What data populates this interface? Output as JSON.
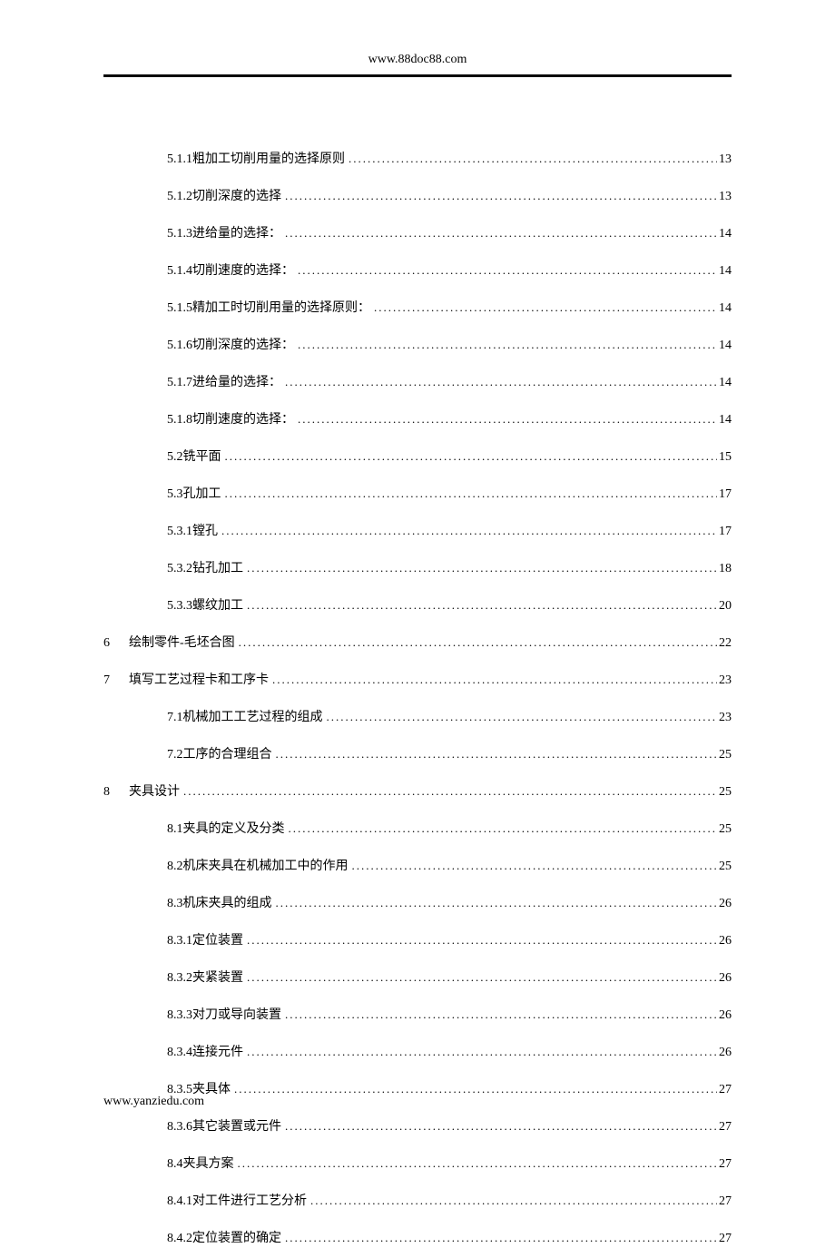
{
  "header": {
    "url": "www.88doc88.com"
  },
  "footer": {
    "url": "www.yanziedu.com"
  },
  "toc": [
    {
      "level": 2,
      "num": "5.1.1",
      "title": "粗加工切削用量的选择原则",
      "page": "13"
    },
    {
      "level": 2,
      "num": "5.1.2",
      "title": " 切削深度的选择",
      "page": "13"
    },
    {
      "level": 2,
      "num": "5.1.3",
      "title": " 进给量的选择：",
      "page": "14"
    },
    {
      "level": 2,
      "num": "5.1.4",
      "title": " 切削速度的选择：",
      "page": "14"
    },
    {
      "level": 2,
      "num": "5.1.5",
      "title": " 精加工时切削用量的选择原则：",
      "page": "14"
    },
    {
      "level": 2,
      "num": "5.1.6",
      "title": " 切削深度的选择：",
      "page": "14"
    },
    {
      "level": 2,
      "num": "5.1.7",
      "title": " 进给量的选择：",
      "page": "14"
    },
    {
      "level": 2,
      "num": "5.1.8",
      "title": " 切削速度的选择：",
      "page": "14"
    },
    {
      "level": 2,
      "num": "5.2",
      "title": "   铣平面",
      "page": "15"
    },
    {
      "level": 2,
      "num": "5.3",
      "title": " 孔加工",
      "page": "17"
    },
    {
      "level": 2,
      "num": "5.3.1",
      "title": " 镗孔",
      "page": "17"
    },
    {
      "level": 2,
      "num": "5.3.2",
      "title": " 钻孔加工",
      "page": "18"
    },
    {
      "level": 2,
      "num": "5.3.3",
      "title": " 螺纹加工",
      "page": "20"
    },
    {
      "level": 0,
      "num": "6",
      "title": "绘制零件-毛坯合图",
      "page": "22"
    },
    {
      "level": 0,
      "num": "7",
      "title": "填写工艺过程卡和工序卡",
      "page": "23"
    },
    {
      "level": 2,
      "num": "7.1",
      "title": " 机械加工工艺过程的组成",
      "page": "23"
    },
    {
      "level": 2,
      "num": "7.2",
      "title": " 工序的合理组合",
      "page": "25"
    },
    {
      "level": 0,
      "num": "8",
      "title": "夹具设计",
      "page": "25"
    },
    {
      "level": 2,
      "num": "8.1",
      "title": "   夹具的定义及分类",
      "page": "25"
    },
    {
      "level": 2,
      "num": "8.2",
      "title": "   机床夹具在机械加工中的作用",
      "page": "25"
    },
    {
      "level": 2,
      "num": "8.3",
      "title": "   机床夹具的组成",
      "page": "26"
    },
    {
      "level": 2,
      "num": "8.3.1",
      "title": "   定位装置",
      "page": "26"
    },
    {
      "level": 2,
      "num": "8.3.2",
      "title": "   夹紧装置",
      "page": "26"
    },
    {
      "level": 2,
      "num": "8.3.3",
      "title": "   对刀或导向装置",
      "page": "26"
    },
    {
      "level": 2,
      "num": "8.3.4",
      "title": "   连接元件",
      "page": "26"
    },
    {
      "level": 2,
      "num": "8.3.5",
      "title": "   夹具体",
      "page": "27"
    },
    {
      "level": 2,
      "num": "8.3.6",
      "title": "   其它装置或元件",
      "page": "27"
    },
    {
      "level": 2,
      "num": "8.4",
      "title": " 夹具方案",
      "page": "27"
    },
    {
      "level": 2,
      "num": "8.4.1",
      "title": "   对工件进行工艺分析",
      "page": "27"
    },
    {
      "level": 2,
      "num": "8.4.2",
      "title": "   定位装置的确定",
      "page": "27"
    }
  ]
}
